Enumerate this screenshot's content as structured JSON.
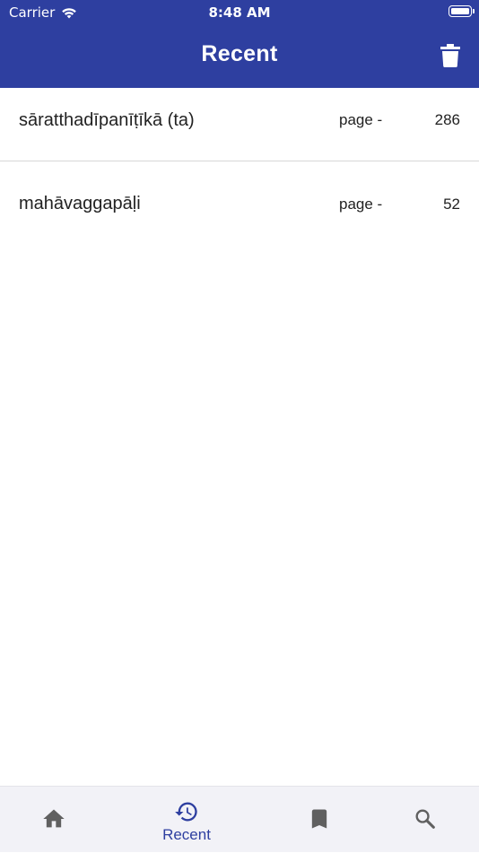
{
  "status_bar": {
    "carrier": "Carrier",
    "time": "8:48 AM"
  },
  "app_bar": {
    "title": "Recent",
    "delete_icon": "trash-icon"
  },
  "recent_list": [
    {
      "title": "sāratthadīpanīṭīkā (ta)",
      "page_label": "page -",
      "page_number": "286"
    },
    {
      "title": "mahāvaggapāḷi",
      "page_label": "page -",
      "page_number": "52"
    }
  ],
  "bottom_nav": {
    "items": [
      {
        "icon": "home-icon",
        "label": ""
      },
      {
        "icon": "history-icon",
        "label": "Recent",
        "selected": true
      },
      {
        "icon": "bookmark-icon",
        "label": ""
      },
      {
        "icon": "search-icon",
        "label": ""
      }
    ]
  },
  "colors": {
    "primary": "#2e3fa0",
    "nav_inactive": "#606060",
    "nav_background": "#f2f2f7"
  }
}
